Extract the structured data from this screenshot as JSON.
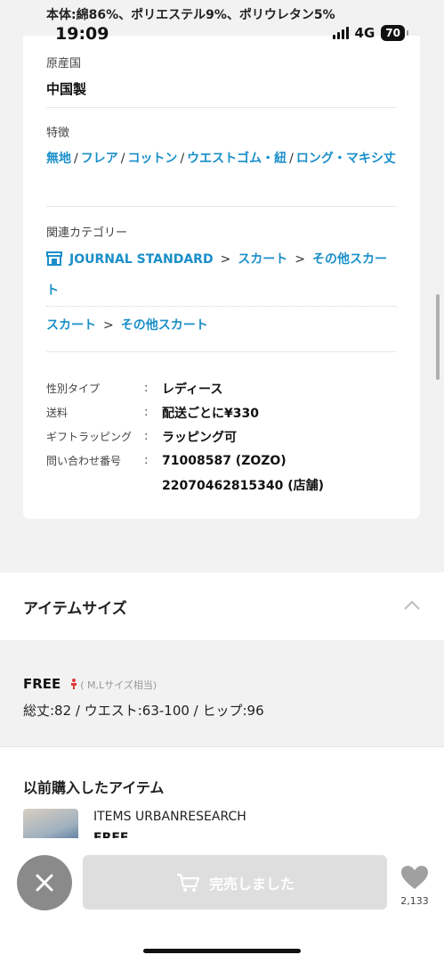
{
  "status": {
    "time": "19:09",
    "network": "4G",
    "battery": "70"
  },
  "material_peek": "本体:綿86%、ポリエステル9%、ポリウレタン5%",
  "origin": {
    "label": "原産国",
    "value": "中国製"
  },
  "features": {
    "label": "特徴",
    "items": [
      "無地",
      "フレア",
      "コットン",
      "ウエストゴム・紐",
      "ロング・マキシ丈"
    ],
    "separator": "/"
  },
  "related": {
    "label": "関連カテゴリー",
    "shop": "JOURNAL STANDARD",
    "line1": [
      "スカート",
      "その他スカート"
    ],
    "line2": [
      "スカート",
      "その他スカート"
    ],
    "arrow": ">"
  },
  "specs": [
    {
      "key": "性別タイプ",
      "value": "レディース"
    },
    {
      "key": "送料",
      "value": "配送ごとに¥330"
    },
    {
      "key": "ギフトラッピング",
      "value": "ラッピング可"
    },
    {
      "key": "問い合わせ番号",
      "value": "71008587 (ZOZO)"
    },
    {
      "key": "",
      "value": "22070462815340 (店舗)"
    }
  ],
  "spec_colon": ":",
  "item_size": {
    "title": "アイテムサイズ",
    "size_name": "FREE",
    "size_note": "( M,Lサイズ相当)",
    "measurements": "総丈:82 / ウエスト:63-100 / ヒップ:96"
  },
  "previous": {
    "title": "以前購入したアイテム",
    "brand": "ITEMS URBANRESEARCH",
    "size": "FREE"
  },
  "bottom": {
    "soldout_label": "完売しました",
    "favorite_count": "2,133"
  },
  "colors": {
    "link": "#1a8fc9",
    "soldout_bg": "#dedede",
    "close_bg": "#8a8a8a"
  }
}
